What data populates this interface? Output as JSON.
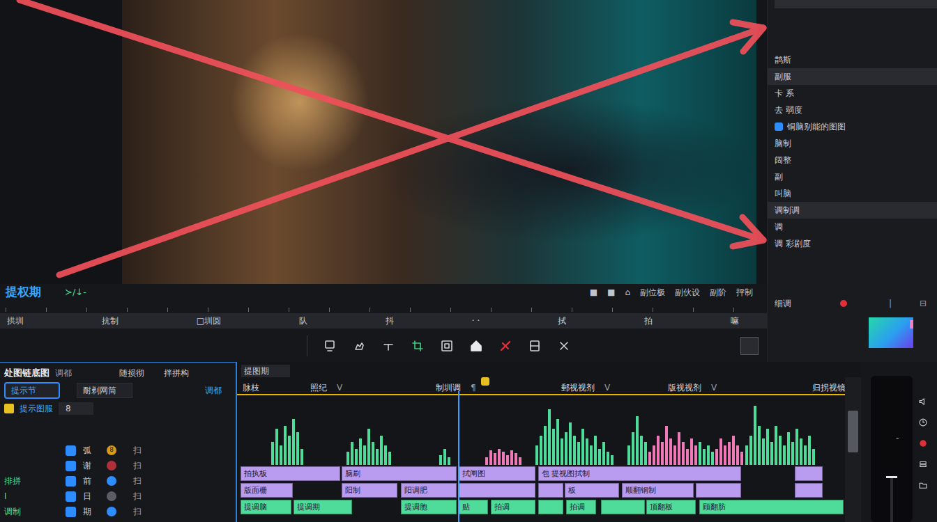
{
  "viewer": {
    "label": "提权期",
    "sub": "≻/↓-",
    "controls": [
      "■",
      "■",
      "⌂",
      "副位极",
      "副伙设",
      "副阶",
      "抨制"
    ],
    "track_labels": [
      "拱圳",
      "抗制",
      "□圳圆",
      "队",
      "抖",
      "· ·",
      "拭",
      "拍",
      "嘛"
    ]
  },
  "inspector": {
    "items": [
      {
        "label": "鹊斯",
        "kind": "text",
        "selected": false
      },
      {
        "label": "副服",
        "kind": "text",
        "selected": true
      },
      {
        "label": "卡 系",
        "kind": "text",
        "selected": false
      },
      {
        "label": "去 弱度",
        "kind": "text",
        "selected": false
      },
      {
        "label": "铜脑别能的图图",
        "kind": "switch",
        "selected": false
      },
      {
        "label": "脑制",
        "kind": "text",
        "selected": false
      },
      {
        "label": "阔整",
        "kind": "text",
        "selected": false
      },
      {
        "label": "副",
        "kind": "text",
        "selected": false
      },
      {
        "label": "叫脑",
        "kind": "text",
        "selected": false
      },
      {
        "label": "调制调",
        "kind": "text",
        "selected": true
      },
      {
        "label": "调",
        "kind": "text",
        "selected": false
      },
      {
        "label": "调 彩剧度",
        "kind": "text",
        "selected": false
      }
    ],
    "color_label": "细调",
    "color_marks": [
      "|",
      "⊟"
    ]
  },
  "media": {
    "title": "处图链底图",
    "aside": "调都",
    "columns": [
      "随损彻",
      "拌拼构"
    ],
    "search": {
      "value": "提示节",
      "selected": true
    },
    "filter": "耐剃网筒",
    "filter_aside": "调都",
    "group": "提示图服",
    "group_count": "8",
    "tracks": [
      {
        "on": true,
        "name": "弧",
        "dot_text": "8",
        "color": "#d89a1a",
        "tail": "扫"
      },
      {
        "on": true,
        "name": "谢",
        "dot_text": "",
        "color": "#b0303a",
        "tail": "扫"
      },
      {
        "tag": "排拼",
        "on": true,
        "name": "前",
        "dot_text": "",
        "color": "#2d8cff",
        "tail": "扫"
      },
      {
        "tag": "I",
        "on": true,
        "name": "日",
        "dot_text": "",
        "color": "#5a5d66",
        "tail": "扫"
      },
      {
        "tag": "调制",
        "on": true,
        "name": "期",
        "dot_text": "",
        "color": "#2d8cff",
        "tail": "扫"
      }
    ]
  },
  "timeline": {
    "title": "提图期",
    "ruler": [
      {
        "label": "脉枝"
      },
      {
        "label": "照纪",
        "mark": "V"
      },
      {
        "label": "制圳调",
        "mark": "¶"
      },
      {
        "label": "郵视视剂",
        "mark": "V"
      },
      {
        "label": "版视视剂",
        "mark": "V"
      },
      {
        "label": "归拐视镜"
      }
    ],
    "waveform": [
      {
        "color": "#4fdc9a",
        "values": [
          0,
          0,
          0,
          0,
          0,
          0,
          0,
          0
        ]
      },
      {
        "color": "#4fdc9a",
        "values": [
          0.35,
          0.55,
          0.3,
          0.6,
          0.45,
          0.7,
          0.5,
          0.25
        ]
      },
      {
        "color": "#4fdc9a",
        "values": [
          0,
          0,
          0,
          0,
          0,
          0,
          0,
          0,
          0,
          0
        ]
      },
      {
        "color": "#4fdc9a",
        "values": [
          0.2,
          0.35,
          0.25,
          0.4,
          0.3,
          0.55,
          0.35,
          0.25,
          0.45,
          0.3,
          0.2
        ]
      },
      {
        "color": "#4fdc9a",
        "values": [
          0,
          0,
          0,
          0,
          0,
          0,
          0,
          0,
          0,
          0,
          0
        ]
      },
      {
        "color": "#4fdc9a",
        "values": [
          0.15,
          0.25,
          0.12
        ]
      },
      {
        "color": "#4fdc9a",
        "values": [
          0,
          0,
          0,
          0,
          0,
          0,
          0,
          0
        ]
      },
      {
        "color": "#f07ab8",
        "values": [
          0.12,
          0.22,
          0.18,
          0.25,
          0.2,
          0.15,
          0.22,
          0.18,
          0.12
        ]
      },
      {
        "color": "#4fdc9a",
        "values": [
          0,
          0,
          0
        ]
      },
      {
        "color": "#4fdc9a",
        "values": [
          0.3,
          0.45,
          0.6,
          0.85,
          0.55,
          0.7,
          0.4,
          0.5,
          0.65,
          0.45,
          0.35,
          0.55,
          0.4,
          0.3,
          0.45,
          0.25,
          0.35,
          0.2,
          0.15
        ]
      },
      {
        "color": "#4fdc9a",
        "values": [
          0,
          0,
          0
        ]
      },
      {
        "color": "#4fdc9a",
        "values": [
          0.3,
          0.5,
          0.75,
          0.45,
          0.35
        ]
      },
      {
        "color": "#f07ab8",
        "values": [
          0.2,
          0.3,
          0.45,
          0.35,
          0.6,
          0.4,
          0.3,
          0.5,
          0.35,
          0.25,
          0.4,
          0.3
        ]
      },
      {
        "color": "#4fdc9a",
        "values": [
          0.35,
          0.25,
          0.3,
          0.2
        ]
      },
      {
        "color": "#f07ab8",
        "values": [
          0.25,
          0.4,
          0.3,
          0.35,
          0.45,
          0.3,
          0.2
        ]
      },
      {
        "color": "#4fdc9a",
        "values": [
          0.3,
          0.45,
          0.9,
          0.6,
          0.4,
          0.55,
          0.35,
          0.6,
          0.45,
          0.3,
          0.5,
          0.35,
          0.55,
          0.4,
          0.3,
          0.45,
          0.25
        ]
      },
      {
        "color": "#4fdc9a",
        "values": [
          0,
          0,
          0,
          0,
          0,
          0,
          0
        ]
      }
    ],
    "rows": [
      {
        "color": "#b99cf0",
        "clips": [
          "拍执板",
          "脑刷",
          "拭闸图",
          "包 提视图拭制",
          ""
        ]
      },
      {
        "color": "#b99cf0",
        "clips": [
          "版面栅",
          "阳制",
          "阳调肥",
          "",
          "",
          "板",
          "顺翻钢制",
          "",
          ""
        ]
      },
      {
        "color": "#4fdc9a",
        "clips": [
          "提调脑",
          "提调期",
          "提调胞",
          "贴",
          "拍调",
          "",
          "拍调",
          "",
          "顶翻板",
          "顾翻肪"
        ]
      }
    ]
  },
  "mixer": {
    "level": 0.3,
    "mark": "-"
  }
}
